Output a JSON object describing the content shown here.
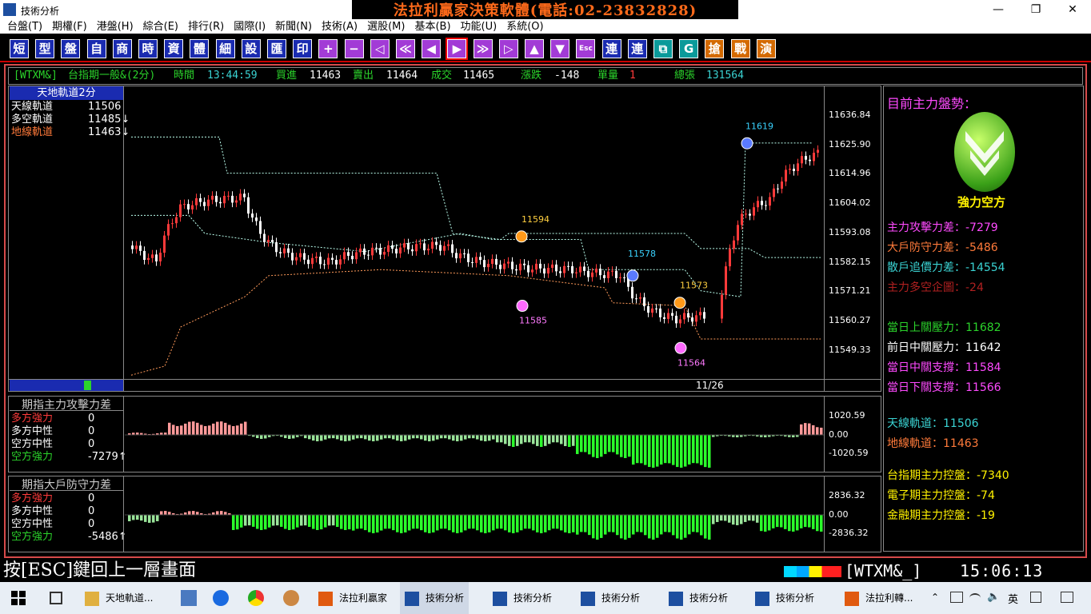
{
  "window": {
    "title": "技術分析",
    "banner": "法拉利贏家決策軟體(電話:02-23832828)",
    "min": "—",
    "max": "❐",
    "close": "✕"
  },
  "menu": [
    "台盤(T)",
    "期權(F)",
    "港盤(H)",
    "綜合(E)",
    "排行(R)",
    "國際(I)",
    "新聞(N)",
    "技術(A)",
    "選股(M)",
    "基本(B)",
    "功能(U)",
    "系統(O)"
  ],
  "toolbar": [
    {
      "label": "短"
    },
    {
      "label": "型"
    },
    {
      "label": "盤"
    },
    {
      "label": "自"
    },
    {
      "label": "商"
    },
    {
      "label": "時"
    },
    {
      "label": "資"
    },
    {
      "label": "體"
    },
    {
      "label": "細"
    },
    {
      "label": "設"
    },
    {
      "label": "匯"
    },
    {
      "label": "印"
    },
    {
      "label": "+"
    },
    {
      "label": "−"
    },
    {
      "label": "◁"
    },
    {
      "label": "≪"
    },
    {
      "label": "◀"
    },
    {
      "label": "▶"
    },
    {
      "label": "≫"
    },
    {
      "label": "▷"
    },
    {
      "label": "▲"
    },
    {
      "label": "▼"
    },
    {
      "label": "Esc"
    },
    {
      "label": "連"
    },
    {
      "label": "連"
    },
    {
      "label": "⧉"
    },
    {
      "label": "G"
    },
    {
      "label": "搶"
    },
    {
      "label": "戰"
    },
    {
      "label": "演"
    }
  ],
  "quote": {
    "symbol": "[WTXM&]",
    "name": "台指期一般&(2分)",
    "time_label": "時間",
    "time": "13:44:59",
    "bid_label": "買進",
    "bid": "11463",
    "ask_label": "賣出",
    "ask": "11464",
    "deal_label": "成交",
    "deal": "11465",
    "chg_label": "漲跌",
    "chg": "-148",
    "vol_label": "單量",
    "vol": "1",
    "total_label": "總張",
    "total": "131564"
  },
  "main_chart": {
    "header": "天地軌道2分",
    "legend": [
      {
        "name": "天線軌道",
        "value": "11506",
        "color": "#ffffff"
      },
      {
        "name": "多空軌道",
        "value": "11485↓",
        "color": "#ffffff"
      },
      {
        "name": "地線軌道",
        "value": "11463↓",
        "color": "#ff7a3a"
      }
    ],
    "y_ticks": [
      "11636.84",
      "11625.90",
      "11614.96",
      "11604.02",
      "11593.08",
      "11582.15",
      "11571.21",
      "11560.27",
      "11549.33"
    ],
    "date_label": "11/26",
    "annotations": [
      {
        "text": "11619",
        "color": "#3ad3ff"
      },
      {
        "text": "11594",
        "color": "#ffd040"
      },
      {
        "text": "11578",
        "color": "#3ad3ff"
      },
      {
        "text": "11573",
        "color": "#ffd040"
      },
      {
        "text": "11585",
        "color": "#ff7aff"
      },
      {
        "text": "11564",
        "color": "#ff7aff"
      }
    ]
  },
  "sub1": {
    "title": "期指主力攻擊力差",
    "legend": [
      {
        "name": "多方強力",
        "value": "0",
        "color": "#ff3a3a"
      },
      {
        "name": "多方中性",
        "value": "0",
        "color": "#ffffff"
      },
      {
        "name": "空方中性",
        "value": "0",
        "color": "#ffffff"
      },
      {
        "name": "空方強力",
        "value": "-7279↑",
        "color": "#2bd42b"
      }
    ],
    "y_ticks": [
      "1020.59",
      "0.00",
      "-1020.59"
    ]
  },
  "sub2": {
    "title": "期指大戶防守力差",
    "legend": [
      {
        "name": "多方強力",
        "value": "0",
        "color": "#ff3a3a"
      },
      {
        "name": "多方中性",
        "value": "0",
        "color": "#ffffff"
      },
      {
        "name": "空方中性",
        "value": "0",
        "color": "#ffffff"
      },
      {
        "name": "空方強力",
        "value": "-5486↑",
        "color": "#2bd42b"
      }
    ],
    "y_ticks": [
      "2836.32",
      "0.00",
      "-2836.32"
    ]
  },
  "side": {
    "heading": "目前主力盤勢：",
    "trend": "強力空方",
    "rows1": [
      {
        "label": "主力攻擊力差：",
        "value": "-7279",
        "color": "#ff4aff"
      },
      {
        "label": "大戶防守力差：",
        "value": "-5486",
        "color": "#ff7a3a"
      },
      {
        "label": "散戶追價力差：",
        "value": "-14554",
        "color": "#3ad3d3"
      },
      {
        "label": "主力多空企圖：",
        "value": "-24",
        "color": "#b02020"
      }
    ],
    "rows2": [
      {
        "label": "當日上關壓力：",
        "value": "11682",
        "color": "#2bd42b"
      },
      {
        "label": "前日中關壓力：",
        "value": "11642",
        "color": "#ffffff"
      },
      {
        "label": "當日中關支撐：",
        "value": "11584",
        "color": "#ff4aff"
      },
      {
        "label": "當日下關支撐：",
        "value": "11566",
        "color": "#ff4aff"
      }
    ],
    "rows3": [
      {
        "label": "天線軌道：",
        "value": "11506",
        "color": "#3ad3d3"
      },
      {
        "label": "地線軌道：",
        "value": "11463",
        "color": "#ff7a3a"
      }
    ],
    "rows4": [
      {
        "label": "台指期主力控盤：",
        "value": "-7340",
        "color": "#fff200"
      },
      {
        "label": "電子期主力控盤：",
        "value": "-74",
        "color": "#fff200"
      },
      {
        "label": "金融期主力控盤：",
        "value": "-19",
        "color": "#fff200"
      }
    ]
  },
  "status": {
    "hint": "按[ESC]鍵回上一層畫面",
    "symbol": "[WTXM&_]",
    "clock": "15:06:13"
  },
  "taskbar": {
    "tasks": [
      {
        "label": "天地軌道..."
      },
      {
        "label": "法拉利贏家"
      },
      {
        "label": "技術分析"
      },
      {
        "label": "技術分析"
      },
      {
        "label": "技術分析"
      },
      {
        "label": "技術分析"
      },
      {
        "label": "技術分析"
      },
      {
        "label": "法拉利轉..."
      }
    ],
    "ime": "英"
  },
  "colors": {
    "up": "#ff3a3a",
    "down": "#ffffff",
    "green": "#2bd42b",
    "sky": "#e8eef5"
  }
}
